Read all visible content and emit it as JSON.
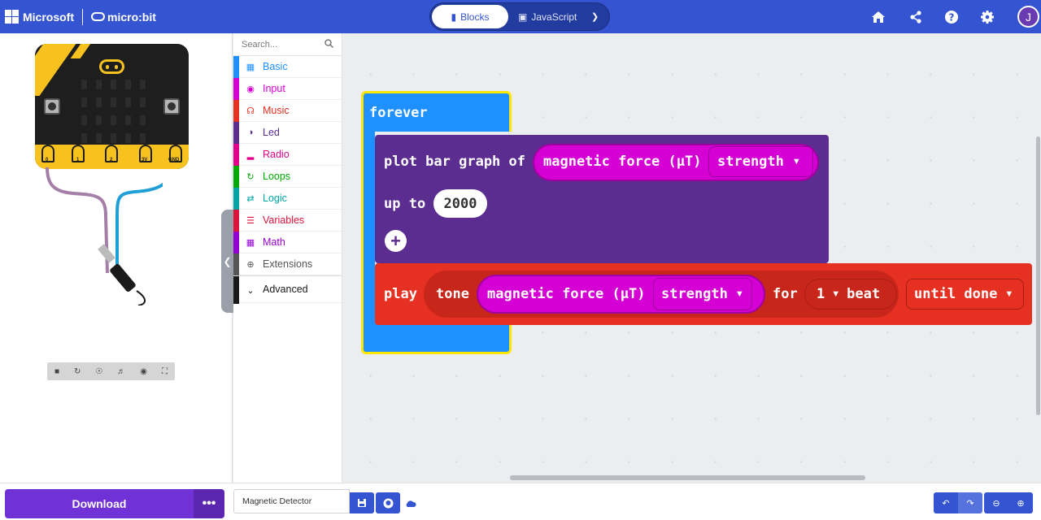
{
  "header": {
    "brand_microsoft": "Microsoft",
    "brand_microbit": "micro:bit",
    "tab_blocks": "Blocks",
    "tab_javascript": "JavaScript",
    "avatar_initial": "J",
    "colors": {
      "bar": "#3454d1",
      "toggle": "#223b9e"
    },
    "icons": [
      "home-icon",
      "share-icon",
      "help-icon",
      "settings-icon"
    ]
  },
  "simulator": {
    "pin_labels": [
      "0",
      "1",
      "2",
      "3V",
      "GND"
    ],
    "lit_led": {
      "row": 3,
      "col": 2
    },
    "toolbar_icons": [
      "stop-icon",
      "restart-icon",
      "debug-icon",
      "mute-icon",
      "screenshot-icon",
      "fullscreen-icon"
    ]
  },
  "toolbox": {
    "search_placeholder": "Search...",
    "categories": [
      {
        "label": "Basic",
        "color": "#1e90ff",
        "icon": "grid-icon"
      },
      {
        "label": "Input",
        "color": "#d400d4",
        "icon": "circle-icon"
      },
      {
        "label": "Music",
        "color": "#e63022",
        "icon": "headphones-icon"
      },
      {
        "label": "Led",
        "color": "#5c2d91",
        "icon": "toggle-icon"
      },
      {
        "label": "Radio",
        "color": "#e3008c",
        "icon": "signal-icon"
      },
      {
        "label": "Loops",
        "color": "#00aa00",
        "icon": "refresh-icon"
      },
      {
        "label": "Logic",
        "color": "#00a4a6",
        "icon": "shuffle-icon"
      },
      {
        "label": "Variables",
        "color": "#dc143c",
        "icon": "list-icon"
      },
      {
        "label": "Math",
        "color": "#9400d3",
        "icon": "calculator-icon"
      },
      {
        "label": "Extensions",
        "color": "#555555",
        "icon": "plus-circle-icon"
      },
      {
        "label": "Advanced",
        "color": "#1a1a1a",
        "icon": "chevron-down-icon"
      }
    ]
  },
  "blocks": {
    "forever": "forever",
    "plot_label": "plot bar graph of",
    "magnetic_force": "magnetic force (µT)",
    "strength": "strength",
    "up_to": "up to",
    "up_to_value": "2000",
    "play": "play",
    "tone": "tone",
    "for": "for",
    "beats": "1",
    "beat": "beat",
    "until_done": "until done",
    "colors": {
      "loops": "#1e90ff",
      "led": "#5c2d91",
      "music": "#e63022",
      "input": "#d400d4"
    }
  },
  "footer": {
    "download": "Download",
    "more": "•••",
    "project_name": "Magnetic Detector"
  }
}
